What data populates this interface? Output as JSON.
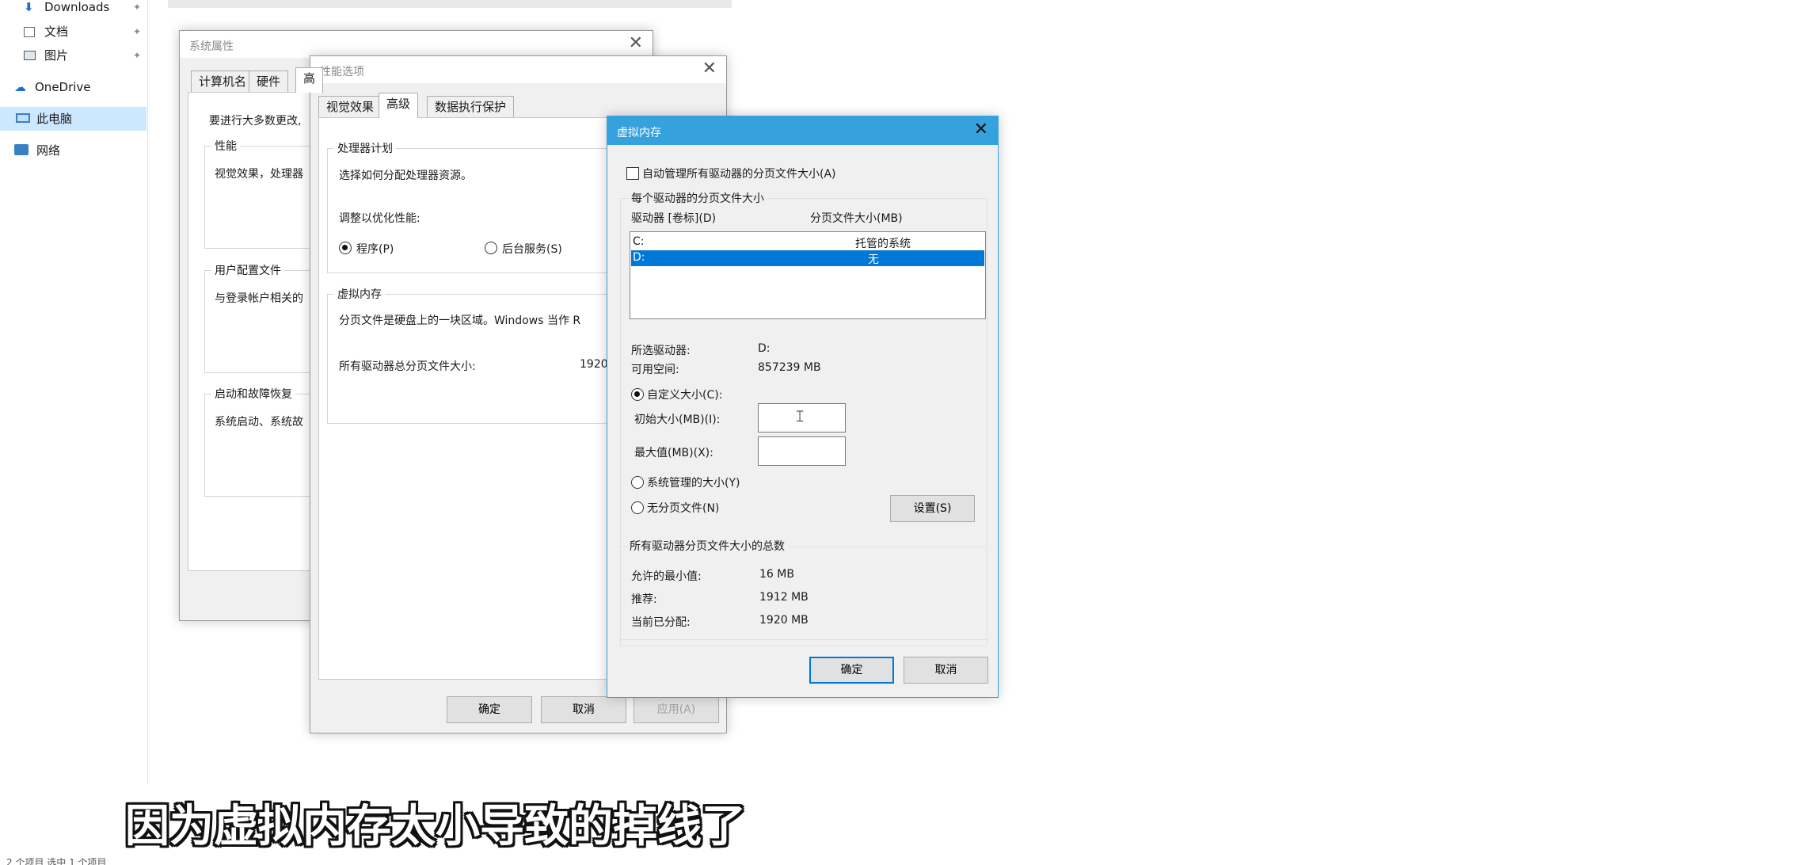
{
  "explorer": {
    "nav": [
      {
        "label": "Downloads",
        "icon": "download-icon"
      },
      {
        "label": "文档",
        "icon": "document-icon"
      },
      {
        "label": "图片",
        "icon": "picture-icon"
      },
      {
        "label": "OneDrive",
        "icon": "cloud-icon"
      },
      {
        "label": "此电脑",
        "icon": "computer-icon",
        "selected": true
      },
      {
        "label": "网络",
        "icon": "network-icon"
      }
    ],
    "status_bar": "2 个项目   选中 1 个项目"
  },
  "sysprops": {
    "title": "系统属性",
    "tabs": [
      "计算机名",
      "硬件",
      "高"
    ],
    "intro": "要进行大多数更改,",
    "groups": [
      {
        "label": "性能",
        "text": "视觉效果，处理器"
      },
      {
        "label": "用户配置文件",
        "text": "与登录帐户相关的"
      },
      {
        "label": "启动和故障恢复",
        "text": "系统启动、系统故"
      }
    ]
  },
  "perfopts": {
    "title": "性能选项",
    "tabs": [
      "视觉效果",
      "高级",
      "数据执行保护"
    ],
    "processor_group": "处理器计划",
    "processor_desc": "选择如何分配处理器资源。",
    "adjust_label": "调整以优化性能:",
    "radio_programs": "程序(P)",
    "radio_background": "后台服务(S)",
    "vm_group": "虚拟内存",
    "vm_desc": "分页文件是硬盘上的一块区域。Windows 当作 R",
    "vm_total_label": "所有驱动器总分页文件大小:",
    "vm_total_value": "1920",
    "ok": "确定",
    "cancel": "取消",
    "apply": "应用(A)"
  },
  "vmem": {
    "title": "虚拟内存",
    "auto_manage": "自动管理所有驱动器的分页文件大小(A)",
    "per_drive_group": "每个驱动器的分页文件大小",
    "col_drive": "驱动器 [卷标](D)",
    "col_size": "分页文件大小(MB)",
    "drives": [
      {
        "drive": "C:",
        "size": "托管的系统",
        "selected": false
      },
      {
        "drive": "D:",
        "size": "无",
        "selected": true
      }
    ],
    "selected_drive_label": "所选驱动器:",
    "selected_drive_value": "D:",
    "free_space_label": "可用空间:",
    "free_space_value": "857239 MB",
    "custom_size": "自定义大小(C):",
    "initial_size_label": "初始大小(MB)(I):",
    "initial_size_value": "",
    "max_size_label": "最大值(MB)(X):",
    "max_size_value": "",
    "system_managed": "系统管理的大小(Y)",
    "no_paging": "无分页文件(N)",
    "set_button": "设置(S)",
    "total_group": "所有驱动器分页文件大小的总数",
    "min_allowed_label": "允许的最小值:",
    "min_allowed_value": "16 MB",
    "recommended_label": "推荐:",
    "recommended_value": "1912 MB",
    "allocated_label": "当前已分配:",
    "allocated_value": "1920 MB",
    "ok": "确定",
    "cancel": "取消",
    "accent": "#36a2dd"
  },
  "caption": "因为虚拟内存太小导致的掉线了"
}
